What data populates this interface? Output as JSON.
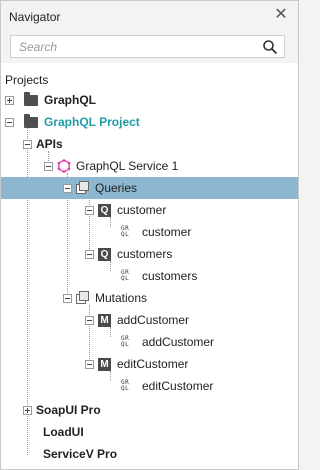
{
  "window": {
    "title": "Navigator",
    "close_glyph": "✕"
  },
  "search": {
    "placeholder": "Search",
    "icon": "search-icon"
  },
  "projects_label": "Projects",
  "tree": [
    {
      "label": "GraphQL",
      "style": "bold",
      "icon": "folder-icon",
      "expander": "plus"
    },
    {
      "label": "GraphQL Project",
      "style": "teal",
      "icon": "folder-icon",
      "expander": "minus"
    },
    {
      "label": "APIs",
      "style": "bold",
      "icon": "none",
      "expander": "minus"
    },
    {
      "label": "GraphQL Service 1",
      "style": "normal",
      "icon": "graphql-service-icon",
      "expander": "minus"
    },
    {
      "label": "Queries",
      "style": "normal",
      "icon": "queries-icon",
      "expander": "minus",
      "selected": true
    },
    {
      "label": "customer",
      "style": "normal",
      "icon": "query-q-icon",
      "expander": "minus"
    },
    {
      "label": "customer",
      "style": "normal",
      "icon": "graphql-icon",
      "expander": "none"
    },
    {
      "label": "customers",
      "style": "normal",
      "icon": "query-q-icon",
      "expander": "minus"
    },
    {
      "label": "customers",
      "style": "normal",
      "icon": "graphql-icon",
      "expander": "none"
    },
    {
      "label": "Mutations",
      "style": "normal",
      "icon": "queries-icon",
      "expander": "minus"
    },
    {
      "label": "addCustomer",
      "style": "normal",
      "icon": "mutation-m-icon",
      "expander": "minus"
    },
    {
      "label": "addCustomer",
      "style": "normal",
      "icon": "graphql-icon",
      "expander": "none"
    },
    {
      "label": "editCustomer",
      "style": "normal",
      "icon": "mutation-m-icon",
      "expander": "minus"
    },
    {
      "label": "editCustomer",
      "style": "normal",
      "icon": "graphql-icon",
      "expander": "none"
    },
    {
      "label": "SoapUI Pro",
      "style": "bold",
      "icon": "none",
      "expander": "plus"
    },
    {
      "label": "LoadUI",
      "style": "bold",
      "icon": "none",
      "expander": "none"
    },
    {
      "label": "ServiceV Pro",
      "style": "bold",
      "icon": "none",
      "expander": "none"
    }
  ],
  "glyphs": {
    "query_letter": "Q",
    "mutation_letter": "M",
    "graphql_top": "GR",
    "graphql_bottom": "QL"
  },
  "colors": {
    "selection": "#8db7d0",
    "project_teal": "#1f9ea8",
    "service_pink": "#e535ab"
  }
}
